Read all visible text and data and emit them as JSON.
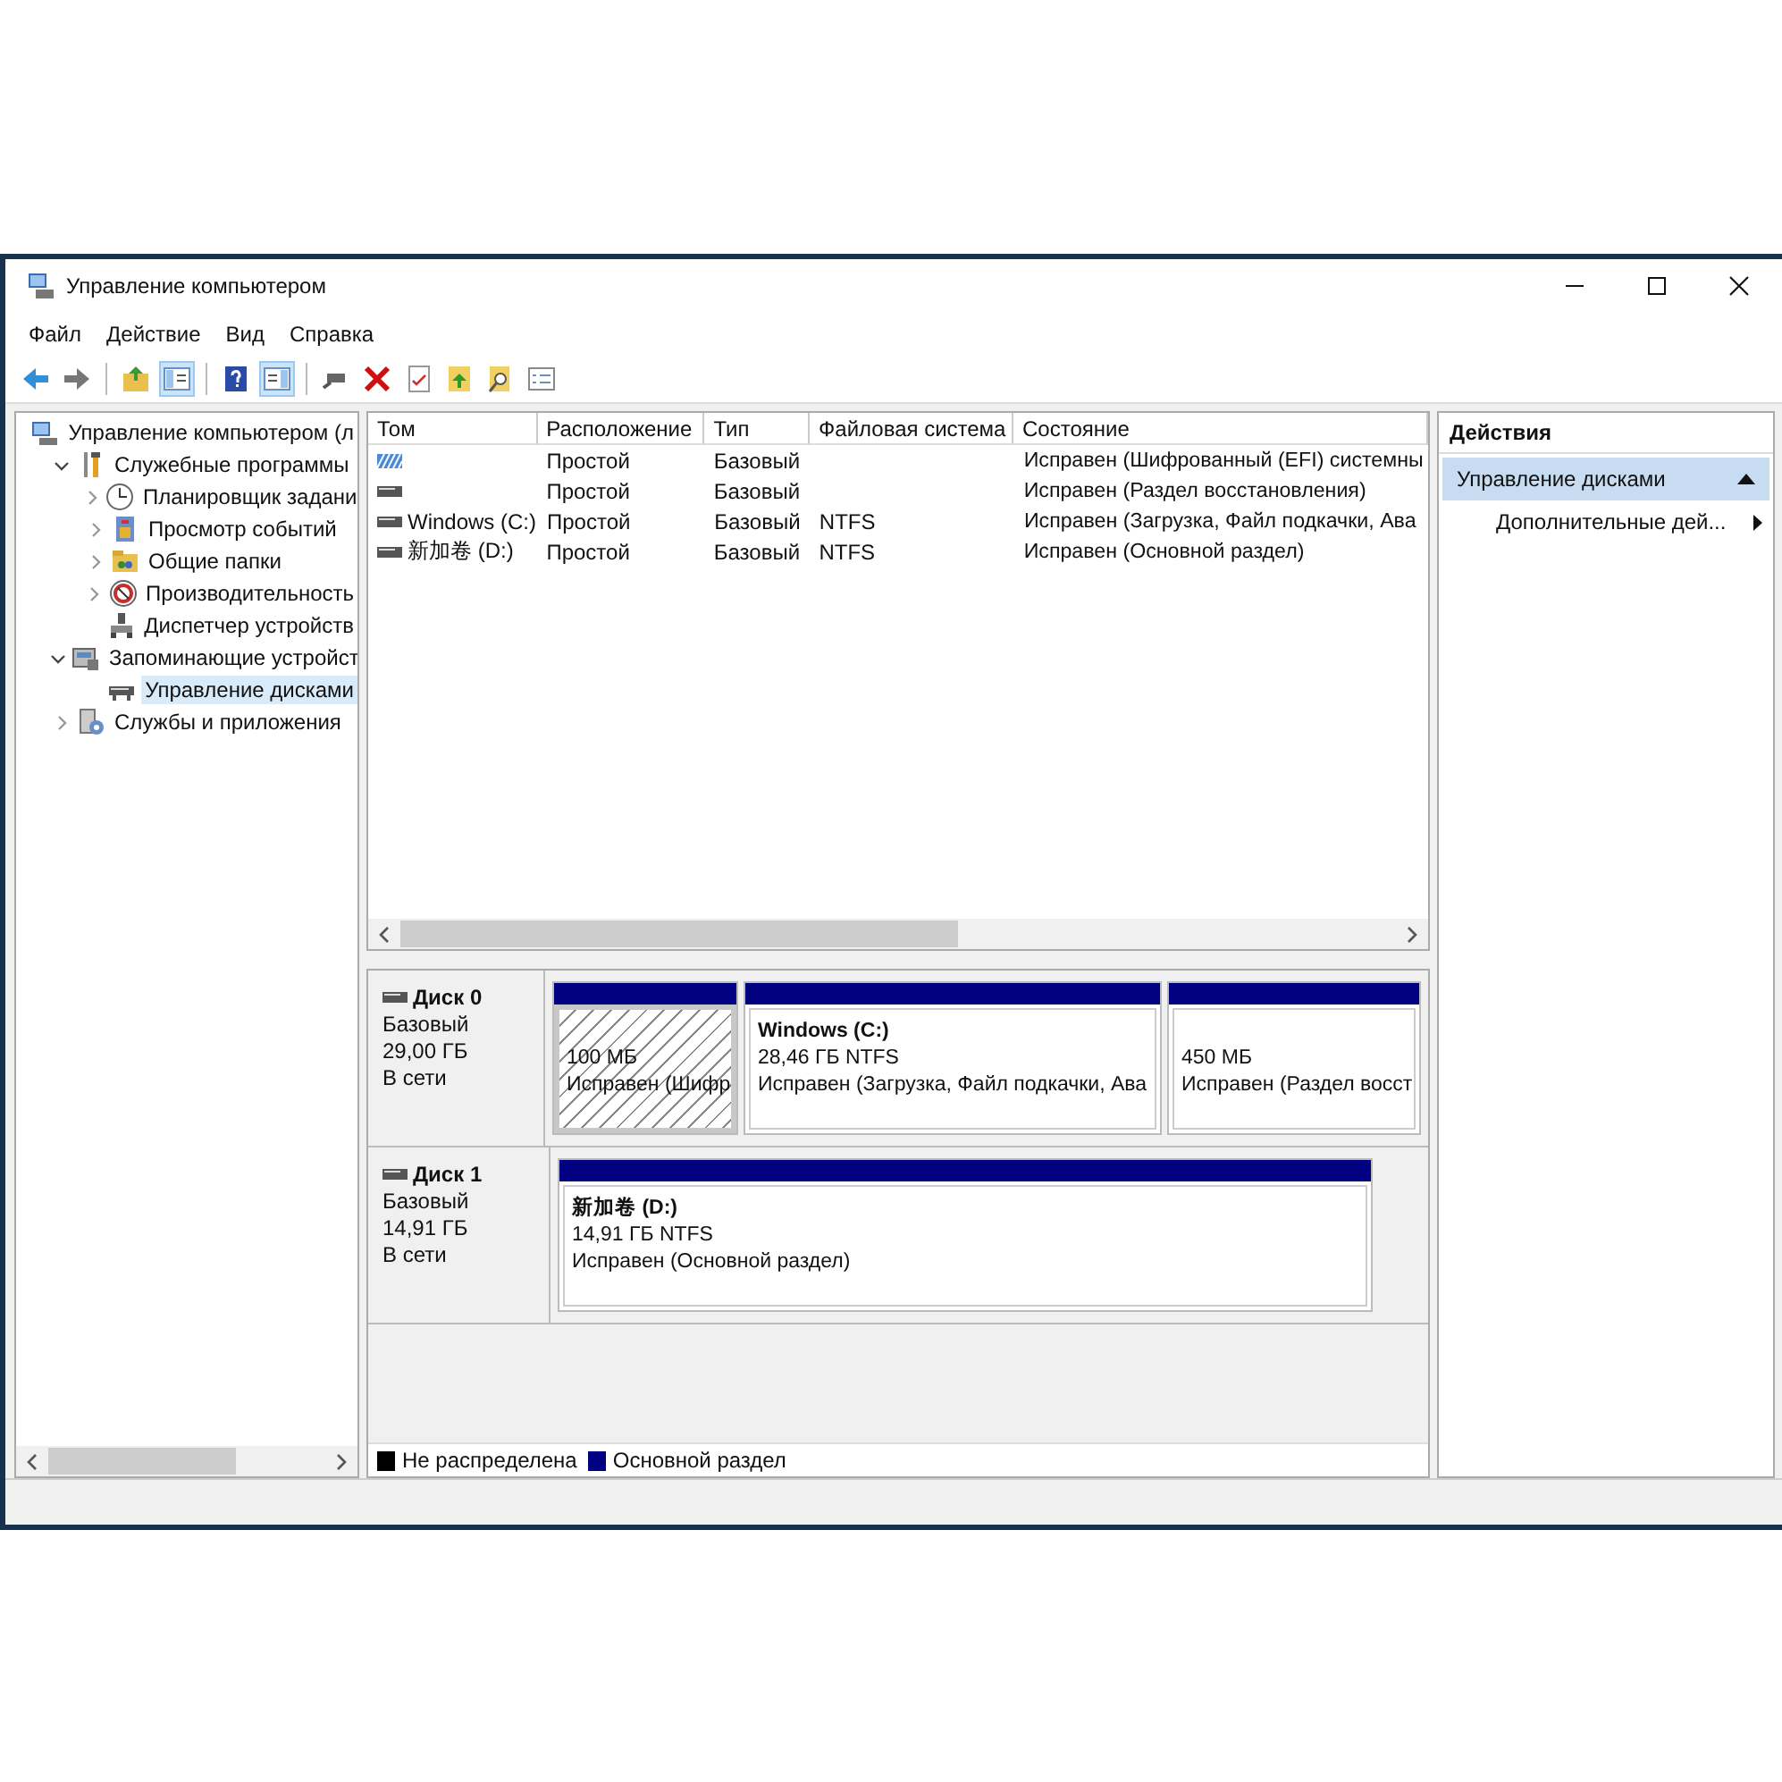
{
  "window": {
    "title": "Управление компьютером"
  },
  "menu": [
    "Файл",
    "Действие",
    "Вид",
    "Справка"
  ],
  "toolbar": [
    {
      "kind": "back",
      "pressed": false
    },
    {
      "kind": "forward",
      "pressed": false
    },
    {
      "kind": "sep"
    },
    {
      "kind": "up",
      "pressed": false
    },
    {
      "kind": "tree",
      "pressed": true
    },
    {
      "kind": "sep"
    },
    {
      "kind": "help",
      "pressed": false
    },
    {
      "kind": "pane",
      "pressed": true
    },
    {
      "kind": "sep"
    },
    {
      "kind": "connect",
      "pressed": false
    },
    {
      "kind": "delete",
      "pressed": false
    },
    {
      "kind": "properties",
      "pressed": false
    },
    {
      "kind": "export",
      "pressed": false
    },
    {
      "kind": "find",
      "pressed": false
    },
    {
      "kind": "list",
      "pressed": false
    }
  ],
  "tree": [
    {
      "label": "Управление компьютером (л",
      "kind": "computer",
      "selected": false,
      "children": [
        {
          "label": "Служебные программы",
          "kind": "tools",
          "expanded": true,
          "selected": false,
          "children": [
            {
              "label": "Планировщик задани",
              "kind": "clock",
              "expanded": false,
              "selected": false
            },
            {
              "label": "Просмотр событий",
              "kind": "events",
              "expanded": false,
              "selected": false
            },
            {
              "label": "Общие папки",
              "kind": "folder",
              "expanded": false,
              "selected": false
            },
            {
              "label": "Производительность",
              "kind": "performance",
              "expanded": false,
              "selected": false
            },
            {
              "label": "Диспетчер устройств",
              "kind": "devices",
              "selected": false
            }
          ]
        },
        {
          "label": "Запоминающие устройст",
          "kind": "storage",
          "expanded": true,
          "selected": false,
          "children": [
            {
              "label": "Управление дисками",
              "kind": "disk",
              "selected": true
            }
          ]
        },
        {
          "label": "Службы и приложения",
          "kind": "services",
          "expanded": false,
          "selected": false
        }
      ]
    }
  ],
  "table": {
    "columns": [
      "Том",
      "Расположение",
      "Тип",
      "Файловая система",
      "Состояние"
    ],
    "rows": [
      {
        "kind": "efi",
        "layout": "Простой",
        "type": "Базовый",
        "status": "Исправен (Шифрованный (EFI) системны"
      },
      {
        "kind": "disk",
        "layout": "Простой",
        "type": "Базовый",
        "status": "Исправен (Раздел восстановления)"
      },
      {
        "kind": "disk",
        "volume": "Windows (C:)",
        "layout": "Простой",
        "type": "Базовый",
        "fs": "NTFS",
        "status": "Исправен (Загрузка, Файл подкачки, Ава"
      },
      {
        "kind": "disk",
        "volume": "新加卷 (D:)",
        "layout": "Простой",
        "type": "Базовый",
        "fs": "NTFS",
        "status": "Исправен (Основной раздел)"
      }
    ]
  },
  "disks": [
    {
      "name": "Диск 0",
      "type": "Базовый",
      "size": "29,00 ГБ",
      "state": "В сети",
      "partitions": [
        {
          "size": "100 МБ",
          "status": "Исправен (Шифр",
          "selected": true
        },
        {
          "name": "Windows  (C:)",
          "size": "28,46 ГБ NTFS",
          "status": "Исправен (Загрузка, Файл подкачки, Ава",
          "selected": false
        },
        {
          "size": "450 МБ",
          "status": "Исправен (Раздел восст",
          "selected": false
        }
      ]
    },
    {
      "name": "Диск 1",
      "type": "Базовый",
      "size": "14,91 ГБ",
      "state": "В сети",
      "partitions": [
        {
          "name": "新加卷  (D:)",
          "size": "14,91 ГБ NTFS",
          "status": "Исправен (Основной раздел)",
          "selected": false
        }
      ]
    }
  ],
  "legend": [
    {
      "label": "Не распределена",
      "color": "#000000"
    },
    {
      "label": "Основной раздел",
      "color": "#000080"
    }
  ],
  "actions": {
    "title": "Действия",
    "section": {
      "label": "Управление дисками",
      "expanded": true
    },
    "items": [
      "Дополнительные дей..."
    ]
  }
}
